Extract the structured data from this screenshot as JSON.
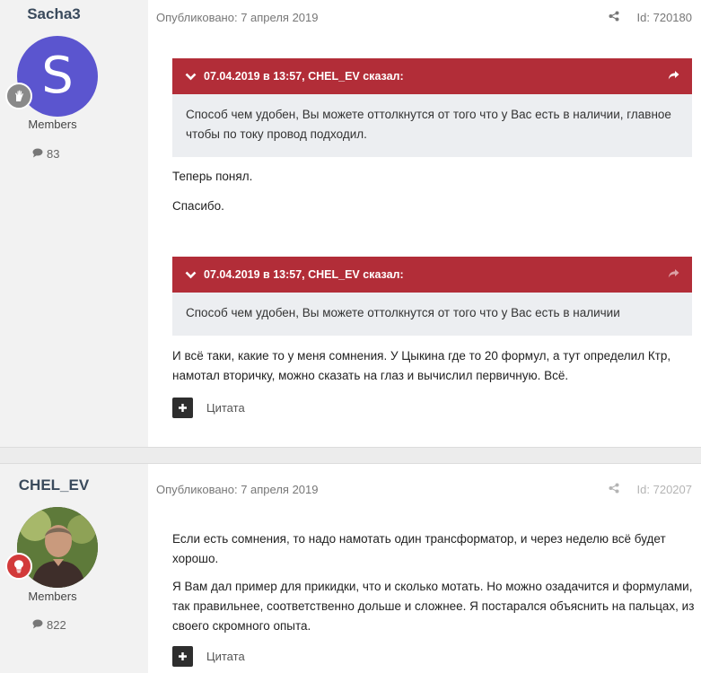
{
  "posts": [
    {
      "author": "Sacha3",
      "avatar_letter": "S",
      "role": "Members",
      "post_count": "83",
      "published": "Опубликовано: 7 апреля 2019",
      "id_label": "Id: 720180",
      "quotes": [
        {
          "header": "07.04.2019 в 13:57, CHEL_EV сказал:",
          "body": "Способ чем удобен, Вы можете оттолкнутся от того что у Вас есть в наличии, главное чтобы по току провод подходил."
        },
        {
          "header": "07.04.2019 в 13:57, CHEL_EV сказал:",
          "body": "Способ чем удобен, Вы можете оттолкнутся от того что у Вас есть в наличии"
        }
      ],
      "paragraphs": [
        "Теперь понял.",
        "Спасибо.",
        "И всё таки, какие то у меня сомнения. У Цыкина где то 20 формул, а тут определил Ктр, намотал вторичку, можно сказать на глаз и вычислил первичную. Всё."
      ],
      "quote_action": "Цитата"
    },
    {
      "author": "CHEL_EV",
      "role": "Members",
      "post_count": "822",
      "published": "Опубликовано: 7 апреля 2019",
      "id_label": "Id: 720207",
      "paragraphs": [
        "Если есть сомнения, то надо намотать один трансформатор, и через неделю всё будет хорошо.",
        "Я Вам дал пример для прикидки, что и сколько мотать. Но можно озадачится и формулами, так правильнее, соответственно дольше и сложнее. Я постарался объяснить на пальцах, из своего скромного опыта."
      ],
      "quote_action": "Цитата"
    }
  ],
  "icons": {
    "share": "share-icon",
    "chevron": "chevron-down-icon",
    "reply_arrow": "reply-arrow-icon",
    "comment": "comment-icon",
    "plus": "plus-icon",
    "rank_hand": "hand-badge-icon",
    "rank_bulb": "bulb-badge-icon"
  },
  "colors": {
    "quote_header": "#b22d38",
    "quote_body": "#eceef1",
    "avatar_bg": "#5b55cf",
    "author_panel": "#f2f2f2",
    "badge_gray": "#8a8a8a",
    "badge_red": "#d23a3a"
  }
}
